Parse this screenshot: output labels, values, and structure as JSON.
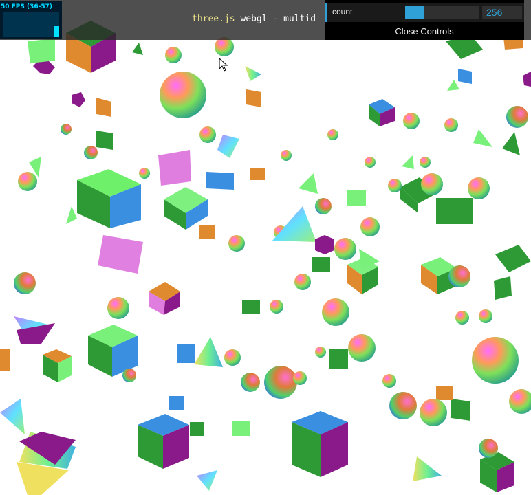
{
  "stats": {
    "fps_text": "50 FPS (36-57)",
    "fps_level_fraction": 0.45
  },
  "header": {
    "title_link": "three.js",
    "title_rest": " webgl - multid"
  },
  "gui": {
    "count_label": "count",
    "count_value": "256",
    "count_fraction": 0.25,
    "close_label": "Close Controls",
    "accent_color": "#2fa1d6"
  },
  "cursor_icon": "arrow-cursor-icon"
}
